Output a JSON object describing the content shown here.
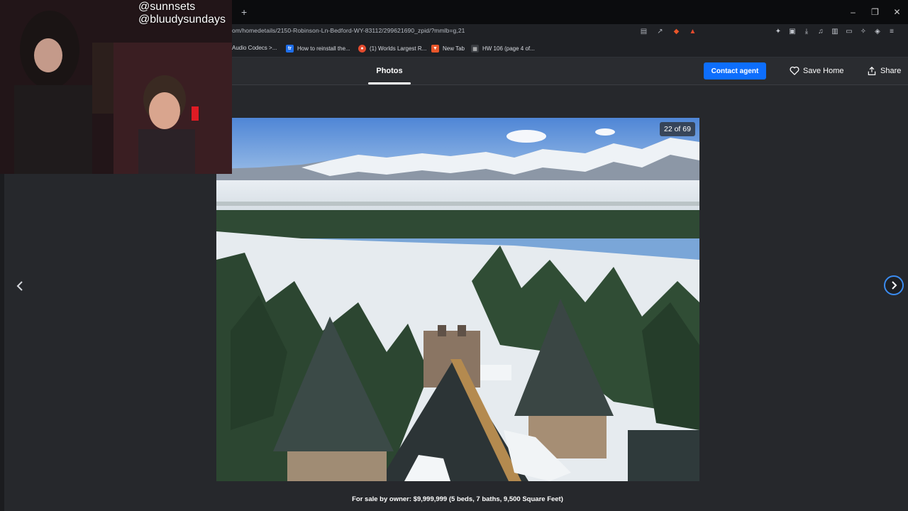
{
  "browser": {
    "new_tab_symbol": "+",
    "window_controls": [
      "–",
      "❐",
      "✕"
    ],
    "url": "om/homedetails/2150-Robinson-Ln-Bedford-WY-83112/299621690_zpid/?mmlb=g,21",
    "bookmarks": [
      {
        "label": "Audio Codecs >...",
        "icon": "bookmark-icon",
        "color": "#2b2d31"
      },
      {
        "label": "How to reinstall the...",
        "icon": "tr-logo-icon",
        "color": "#1f6feb"
      },
      {
        "label": "(1) Worlds Largest R...",
        "icon": "reddit-icon",
        "color": "#e34b2e"
      },
      {
        "label": "New Tab",
        "icon": "brave-icon",
        "color": "#e8562a"
      },
      {
        "label": "HW 106 (page 4 of...",
        "icon": "page-icon",
        "color": "#3a3d42"
      }
    ]
  },
  "header": {
    "active_tab": "Photos",
    "contact_button": "Contact agent",
    "save_home": "Save Home",
    "share": "Share"
  },
  "gallery": {
    "counter": "22 of 69",
    "caption": "For sale by owner: $9,999,999 (5 beds, 7 baths, 9,500 Square Feet)",
    "prev_icon": "chevron-left-icon",
    "next_icon": "chevron-right-icon"
  },
  "overlay": {
    "handle_1": "@sunnsets",
    "handle_2": "@bluudysundays"
  },
  "colors": {
    "accent": "#0d6efd",
    "page_bg": "#26282c"
  }
}
